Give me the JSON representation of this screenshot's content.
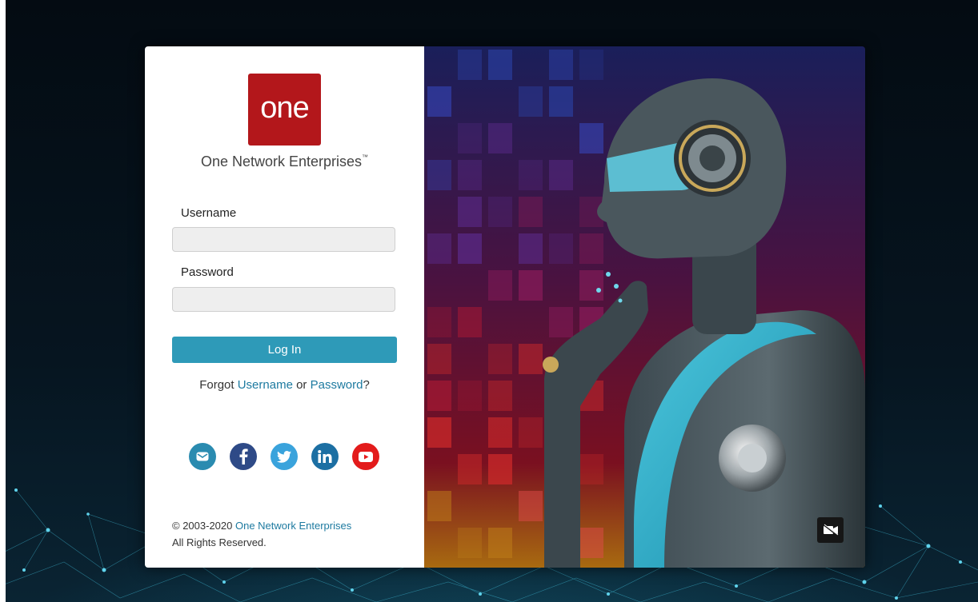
{
  "brand": {
    "logo_text": "one",
    "company_name": "One Network Enterprises",
    "trademark": "™"
  },
  "login_form": {
    "username_label": "Username",
    "username_value": "",
    "password_label": "Password",
    "password_value": "",
    "login_button": "Log In"
  },
  "forgot": {
    "prefix": "Forgot ",
    "username_link": "Username",
    "middle": " or ",
    "password_link": "Password",
    "suffix": "?"
  },
  "social": [
    {
      "name": "email",
      "icon": "email-icon",
      "color": "#2a8bb0"
    },
    {
      "name": "facebook",
      "icon": "facebook-icon",
      "color": "#2e4a87"
    },
    {
      "name": "twitter",
      "icon": "twitter-icon",
      "color": "#3aa3dc"
    },
    {
      "name": "linkedin",
      "icon": "linkedin-icon",
      "color": "#1c6fa3"
    },
    {
      "name": "youtube",
      "icon": "youtube-icon",
      "color": "#e31b1b"
    }
  ],
  "footer": {
    "copyright_prefix": "© 2003-2020 ",
    "company_link": "One Network Enterprises",
    "rights": "All Rights Reserved."
  },
  "hero": {
    "video_toggle_icon": "video-off-icon"
  },
  "colors": {
    "brand_red": "#b3171b",
    "accent_blue": "#2e9ab8",
    "link_blue": "#1d7aa0"
  }
}
